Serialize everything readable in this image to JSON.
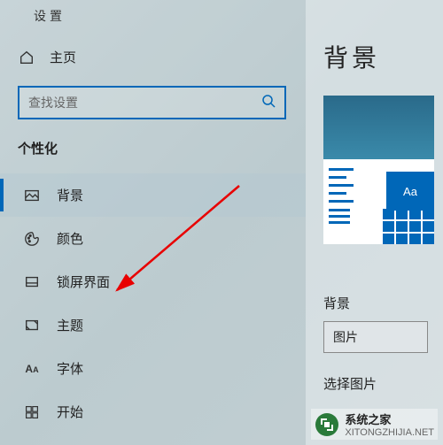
{
  "app_title": "设置",
  "home_label": "主页",
  "search": {
    "placeholder": "查找设置"
  },
  "section_header": "个性化",
  "sidebar": {
    "items": [
      {
        "label": "背景"
      },
      {
        "label": "颜色"
      },
      {
        "label": "锁屏界面"
      },
      {
        "label": "主题"
      },
      {
        "label": "字体"
      },
      {
        "label": "开始"
      }
    ]
  },
  "main": {
    "title": "背景",
    "preview_aa": "Aa",
    "bg_label": "背景",
    "bg_dropdown_value": "图片",
    "select_image_label": "选择图片"
  },
  "watermark": {
    "title": "系统之家",
    "url": "XITONGZHIJIA.NET"
  }
}
